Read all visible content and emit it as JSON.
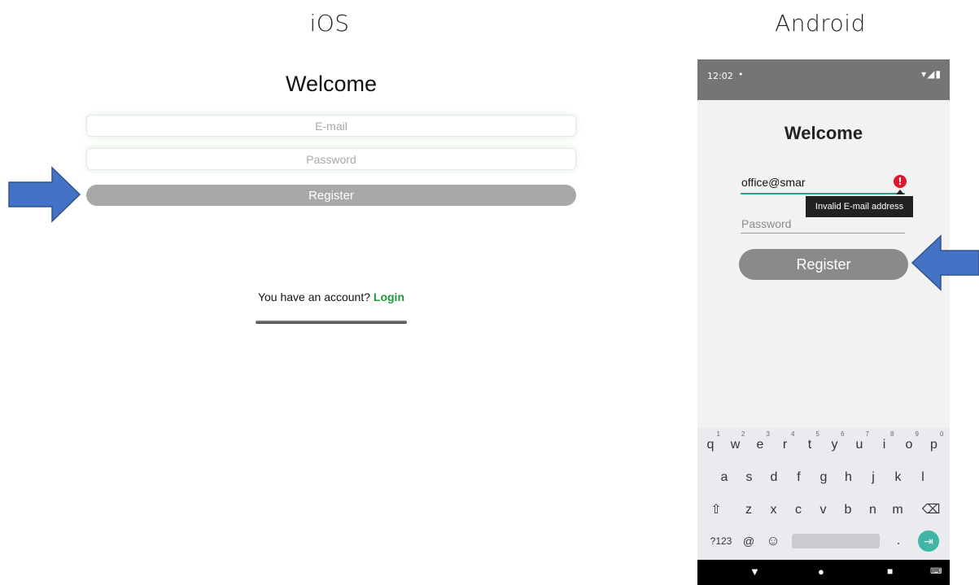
{
  "labels": {
    "ios": "iOS",
    "android": "Android"
  },
  "ios": {
    "title": "Welcome",
    "email_placeholder": "E-mail",
    "password_placeholder": "Password",
    "register_label": "Register",
    "account_prompt": "You have an account?",
    "login_label": "Login"
  },
  "android": {
    "status_bar": {
      "time": "12:02",
      "dot": "•",
      "icons": "▾◢▮"
    },
    "title": "Welcome",
    "email_value": "office@smar",
    "error_icon": "!",
    "error_tooltip": "Invalid E-mail address",
    "password_placeholder": "Password",
    "register_label": "Register",
    "keyboard": {
      "row1": [
        {
          "k": "q",
          "n": "1"
        },
        {
          "k": "w",
          "n": "2"
        },
        {
          "k": "e",
          "n": "3"
        },
        {
          "k": "r",
          "n": "4"
        },
        {
          "k": "t",
          "n": "5"
        },
        {
          "k": "y",
          "n": "6"
        },
        {
          "k": "u",
          "n": "7"
        },
        {
          "k": "i",
          "n": "8"
        },
        {
          "k": "o",
          "n": "9"
        },
        {
          "k": "p",
          "n": "0"
        }
      ],
      "row2": [
        "a",
        "s",
        "d",
        "f",
        "g",
        "h",
        "j",
        "k",
        "l"
      ],
      "row3": [
        "z",
        "x",
        "c",
        "v",
        "b",
        "n",
        "m"
      ],
      "shift": "⇧",
      "backspace": "⌫",
      "symbols": "?123",
      "at": "@",
      "emoji": "☺",
      "period": ".",
      "enter": "⇥"
    },
    "nav": {
      "back": "▼",
      "home": "●",
      "recents": "■",
      "keyboard_switch": "⌨"
    }
  },
  "colors": {
    "ios_button": "#a8a8a8",
    "login_link": "#1e9a3a",
    "android_status_bar": "#757575",
    "android_button": "#8a8a8a",
    "input_underline_active": "#2e9e8a",
    "error_red": "#e0162b",
    "arrow_fill": "#4472c4",
    "arrow_stroke": "#2f528f"
  }
}
